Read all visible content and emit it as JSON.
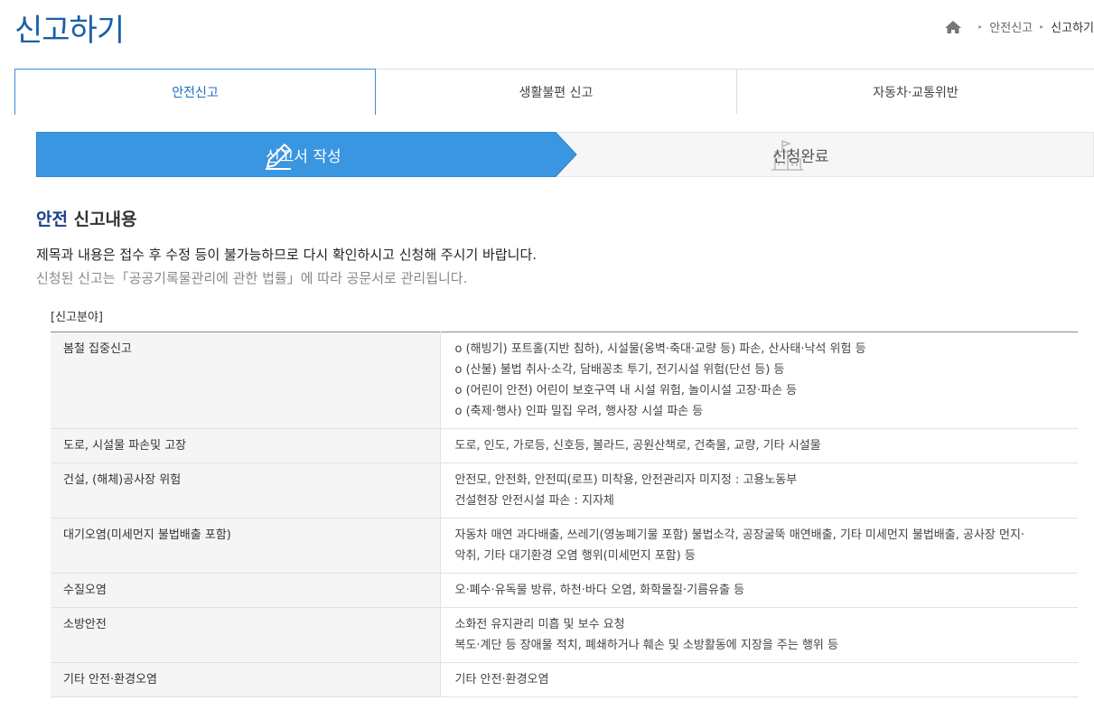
{
  "page": {
    "title": "신고하기"
  },
  "breadcrumb": {
    "items": [
      "안전신고",
      "신고하기"
    ]
  },
  "tabs": [
    {
      "label": "안전신고",
      "active": true
    },
    {
      "label": "생활불편 신고",
      "active": false
    },
    {
      "label": "자동차·교통위반",
      "active": false
    }
  ],
  "steps": [
    {
      "label": "신고서 작성",
      "icon": "pencil-icon",
      "active": true
    },
    {
      "label": "신청완료",
      "icon": "building-flag-icon",
      "active": false
    }
  ],
  "section": {
    "title_accent": "안전",
    "title_rest": " 신고내용",
    "notice1": "제목과 내용은 접수 후 수정 등이 불가능하므로 다시 확인하시고 신청해 주시기 바랍니다.",
    "notice2": "신청된 신고는「공공기록물관리에 관한 법률」에 따라 공문서로 관리됩니다."
  },
  "table": {
    "label": "[신고분야]",
    "rows": [
      {
        "category": "봄철 집중신고",
        "lines": [
          "o (해빙기) 포트홀(지반 침하), 시설물(옹벽·축대·교량 등) 파손, 산사태·낙석 위험 등",
          "o (산불) 불법 취사·소각, 담배꽁초 투기, 전기시설 위험(단선 등) 등",
          "o (어린이 안전) 어린이 보호구역 내 시설 위험, 놀이시설 고장·파손 등",
          "o (축제·행사) 인파 밀집 우려, 행사장 시설 파손 등"
        ]
      },
      {
        "category": "도로, 시설물 파손및 고장",
        "lines": [
          "도로, 인도, 가로등, 신호등, 볼라드, 공원산책로, 건축물, 교량, 기타 시설물"
        ]
      },
      {
        "category": "건설, (해체)공사장 위험",
        "lines": [
          "안전모, 안전화, 안전띠(로프) 미착용, 안전관리자 미지정 : 고용노동부",
          "건설현장 안전시설 파손 : 지자체"
        ]
      },
      {
        "category": "대기오염(미세먼지 불법배출 포함)",
        "lines": [
          "자동차 매연 과다배출, 쓰레기(영농폐기물 포함) 불법소각, 공장굴뚝 매연배출, 기타 미세먼지 불법배출, 공사장 먼지·",
          "악취, 기타 대기환경 오염 행위(미세먼지 포함) 등"
        ]
      },
      {
        "category": "수질오염",
        "lines": [
          "오·폐수·유독물 방류, 하천·바다 오염, 화학물질·기름유출 등"
        ]
      },
      {
        "category": "소방안전",
        "lines": [
          "소화전 유지관리 미흡 및 보수 요청",
          "복도·계단 등 장애물 적치, 폐쇄하거나 훼손 및 소방활동에 지장을 주는 행위 등"
        ]
      },
      {
        "category": "기타 안전·환경오염",
        "lines": [
          "기타 안전·환경오염"
        ]
      }
    ]
  },
  "colors": {
    "accent": "#3a8fd6",
    "title": "#1a5fa8",
    "step_active": "#3a96e0"
  }
}
